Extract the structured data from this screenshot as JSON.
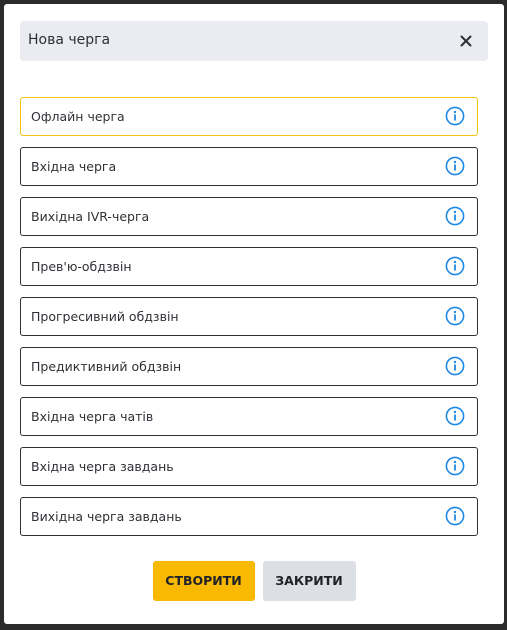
{
  "dialog": {
    "title": "Нова черга"
  },
  "queue_types": [
    {
      "label": "Офлайн черга",
      "selected": true
    },
    {
      "label": "Вхідна черга",
      "selected": false
    },
    {
      "label": "Вихідна IVR-черга",
      "selected": false
    },
    {
      "label": "Прев'ю-обдзвін",
      "selected": false
    },
    {
      "label": "Прогресивний обдзвін",
      "selected": false
    },
    {
      "label": "Предиктивний обдзвін",
      "selected": false
    },
    {
      "label": "Вхідна черга чатів",
      "selected": false
    },
    {
      "label": "Вхідна черга завдань",
      "selected": false
    },
    {
      "label": "Вихідна черга завдань",
      "selected": false
    }
  ],
  "footer": {
    "create_label": "СТВОРИТИ",
    "close_label": "ЗАКРИТИ"
  },
  "colors": {
    "accent": "#f9b900",
    "selected_border": "#f1c40f",
    "info_icon": "#1e88e5",
    "header_bg": "#ebecf1"
  },
  "icons": {
    "close": "close-icon",
    "info": "info-icon"
  }
}
